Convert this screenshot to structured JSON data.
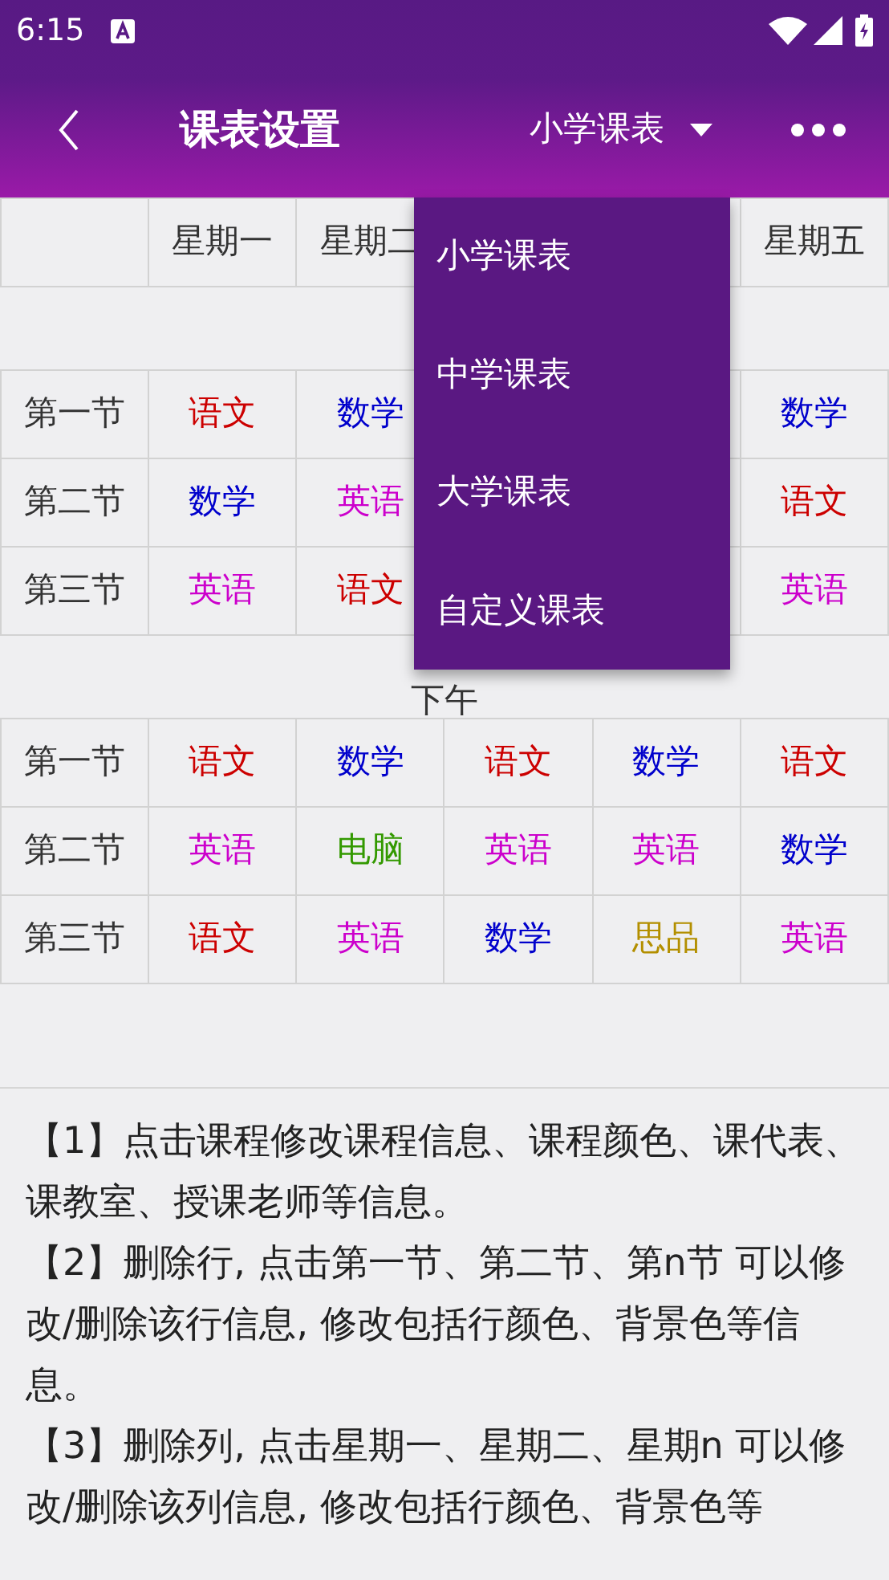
{
  "status_bar": {
    "time": "6:15"
  },
  "toolbar": {
    "title": "课表设置",
    "selector": "小学课表"
  },
  "table": {
    "columns": [
      "星期一",
      "星期二",
      null,
      null,
      "星期五"
    ],
    "sections": [
      {
        "rows": [
          {
            "label": "第一节",
            "cells": [
              {
                "text": "语文",
                "color": "#cc0000"
              },
              {
                "text": "数学",
                "color": "#0000cc"
              },
              null,
              null,
              {
                "text": "数学",
                "color": "#0000cc"
              }
            ]
          },
          {
            "label": "第二节",
            "cells": [
              {
                "text": "数学",
                "color": "#0000cc"
              },
              {
                "text": "英语",
                "color": "#cc00cc"
              },
              null,
              null,
              {
                "text": "语文",
                "color": "#cc0000"
              }
            ]
          },
          {
            "label": "第三节",
            "cells": [
              {
                "text": "英语",
                "color": "#cc00cc"
              },
              {
                "text": "语文",
                "color": "#cc0000"
              },
              null,
              null,
              {
                "text": "英语",
                "color": "#cc00cc"
              }
            ]
          }
        ]
      },
      {
        "label": "下午",
        "rows": [
          {
            "label": "第一节",
            "cells": [
              {
                "text": "语文",
                "color": "#cc0000"
              },
              {
                "text": "数学",
                "color": "#0000cc"
              },
              {
                "text": "语文",
                "color": "#cc0000"
              },
              {
                "text": "数学",
                "color": "#0000cc"
              },
              {
                "text": "语文",
                "color": "#cc0000"
              }
            ]
          },
          {
            "label": "第二节",
            "cells": [
              {
                "text": "英语",
                "color": "#cc00cc"
              },
              {
                "text": "电脑",
                "color": "#339900"
              },
              {
                "text": "英语",
                "color": "#cc00cc"
              },
              {
                "text": "英语",
                "color": "#cc00cc"
              },
              {
                "text": "数学",
                "color": "#0000cc"
              }
            ]
          },
          {
            "label": "第三节",
            "cells": [
              {
                "text": "语文",
                "color": "#cc0000"
              },
              {
                "text": "英语",
                "color": "#cc00cc"
              },
              {
                "text": "数学",
                "color": "#0000cc"
              },
              {
                "text": "思品",
                "color": "#b38f00"
              },
              {
                "text": "英语",
                "color": "#cc00cc"
              }
            ]
          }
        ]
      }
    ]
  },
  "menu": {
    "items": [
      "小学课表",
      "中学课表",
      "大学课表",
      "自定义课表"
    ]
  },
  "notes": [
    "【1】点击课程修改课程信息、课程颜色、课代表、课教室、授课老师等信息。",
    "【2】删除行, 点击第一节、第二节、第n节 可以修改/删除该行信息, 修改包括行颜色、背景色等信息。",
    "【3】删除列, 点击星期一、星期二、星期n 可以修改/删除该列信息, 修改包括行颜色、背景色等"
  ]
}
